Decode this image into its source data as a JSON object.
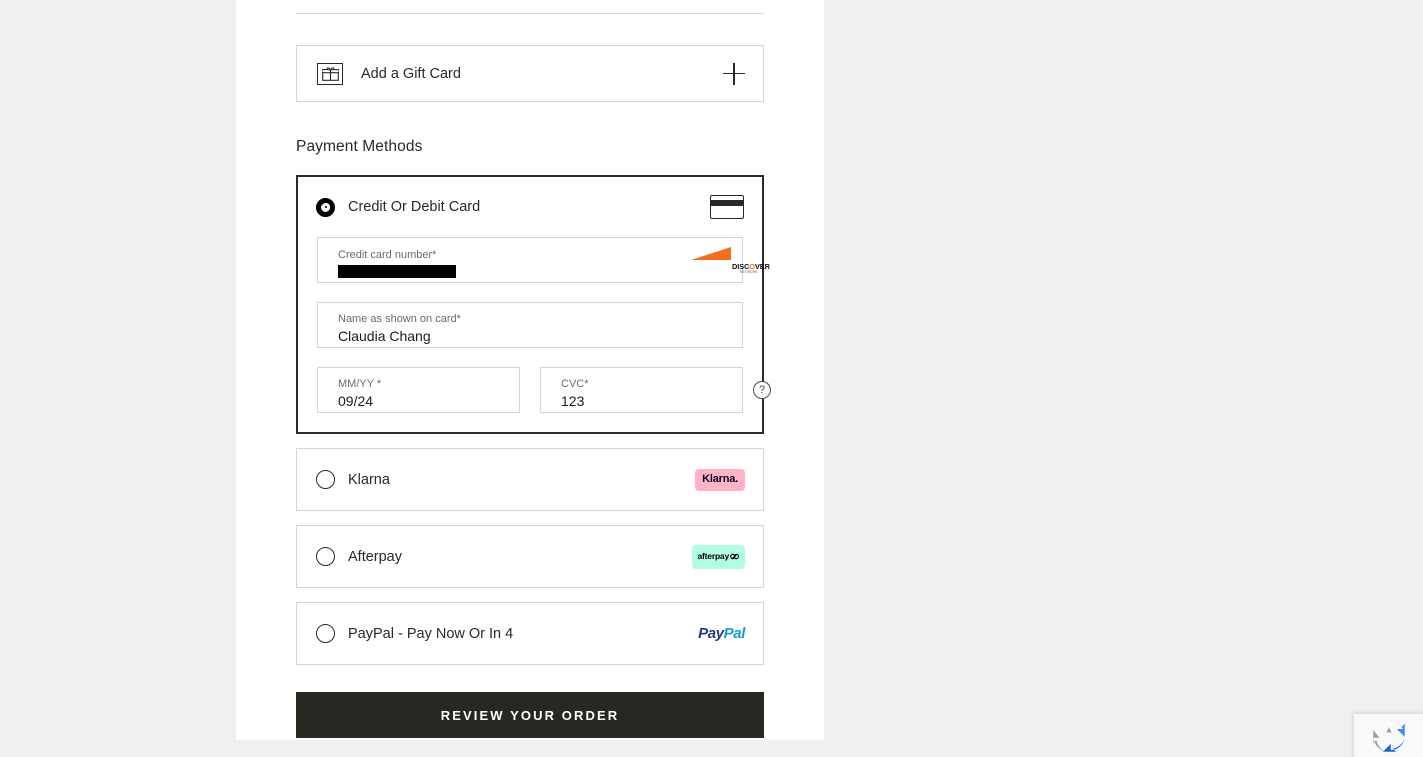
{
  "gift_card": {
    "label": "Add a Gift Card",
    "icon": "gift-card-icon",
    "action_icon": "plus-icon"
  },
  "section": {
    "heading": "Payment Methods"
  },
  "payment_methods": [
    {
      "id": "credit-debit-card",
      "label": "Credit Or Debit Card",
      "selected": true,
      "brand_icon": "credit-card-icon"
    },
    {
      "id": "klarna",
      "label": "Klarna",
      "selected": false,
      "brand_icon": "klarna-logo",
      "brand_text": "Klarna.",
      "brand_bg": "#FFB3C7",
      "brand_fg": "#0B051D"
    },
    {
      "id": "afterpay",
      "label": "Afterpay",
      "selected": false,
      "brand_icon": "afterpay-logo",
      "brand_text": "afterpay",
      "brand_bg": "#B2FCE4",
      "brand_fg": "#000000"
    },
    {
      "id": "paypal",
      "label": "PayPal - Pay Now Or In 4",
      "selected": false,
      "brand_icon": "paypal-logo",
      "brand_text_a": "Pay",
      "brand_text_b": "Pal",
      "brand_fg_a": "#253B80",
      "brand_fg_b": "#179BD7"
    }
  ],
  "card_form": {
    "number": {
      "label": "Credit card number*",
      "value": "",
      "redacted": true,
      "detected_brand": "discover",
      "brand_text": "DISC",
      "brand_text_o": "O",
      "brand_text_end": "VER",
      "brand_sub": "NETWORK"
    },
    "name": {
      "label": "Name as shown on card*",
      "value": "Claudia Chang"
    },
    "expiry": {
      "label": "MM/YY *",
      "value": "09/24"
    },
    "cvc": {
      "label": "CVC*",
      "value": "123",
      "help_icon": "question-mark-icon",
      "help_glyph": "?"
    }
  },
  "submit": {
    "label": "Review Your Order",
    "bg": "#292722",
    "fg": "#FFFFFF"
  },
  "recaptcha": {
    "name": "recaptcha-badge",
    "colors": {
      "blue": "#4285F4",
      "dark_blue": "#1B66C9",
      "gray": "#9AA0A6"
    }
  }
}
